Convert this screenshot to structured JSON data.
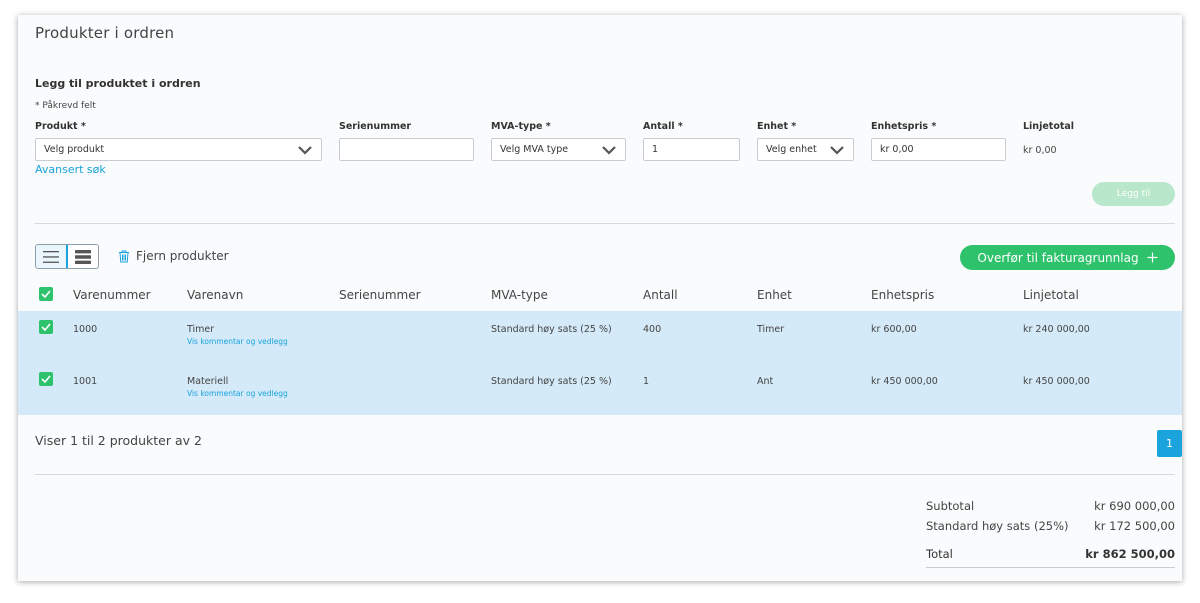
{
  "header": {
    "title": "Produkter i ordren"
  },
  "add_form": {
    "section_title": "Legg til produktet i ordren",
    "required_note": "* Påkrevd felt",
    "labels": {
      "produkt": "Produkt *",
      "serienummer": "Serienummer",
      "mva": "MVA-type *",
      "antall": "Antall *",
      "enhet": "Enhet *",
      "enhetspris": "Enhetspris *",
      "linjetotal": "Linjetotal"
    },
    "fields": {
      "produkt_placeholder": "Velg produkt",
      "serienummer_value": "",
      "mva_placeholder": "Velg MVA type",
      "antall_value": "1",
      "enhet_placeholder": "Velg enhet",
      "enhetspris_value": "kr 0,00",
      "linjetotal_value": "kr 0,00"
    },
    "advanced_search": "Avansert søk",
    "add_button": "Legg til"
  },
  "toolbar": {
    "remove_label": "Fjern produkter",
    "transfer_button": "Overfør til fakturagrunnlag",
    "transfer_icon": "plus-icon"
  },
  "table": {
    "headers": {
      "varenummer": "Varenummer",
      "varenavn": "Varenavn",
      "serienummer": "Serienummer",
      "mva": "MVA-type",
      "antall": "Antall",
      "enhet": "Enhet",
      "enhetspris": "Enhetspris",
      "linjetotal": "Linjetotal"
    },
    "rows": [
      {
        "varenummer": "1000",
        "varenavn": "Timer",
        "sublink": "Vis kommentar og vedlegg",
        "serienummer": "",
        "mva": "Standard høy sats (25 %)",
        "antall": "400",
        "enhet": "Timer",
        "enhetspris": "kr 600,00",
        "linjetotal": "kr 240 000,00"
      },
      {
        "varenummer": "1001",
        "varenavn": "Materiell",
        "sublink": "Vis kommentar og vedlegg",
        "serienummer": "",
        "mva": "Standard høy sats (25 %)",
        "antall": "1",
        "enhet": "Ant",
        "enhetspris": "kr 450 000,00",
        "linjetotal": "kr 450 000,00"
      }
    ]
  },
  "pagination": {
    "summary": "Viser 1 til 2 produkter av 2",
    "current_page": "1"
  },
  "totals": {
    "subtotal_label": "Subtotal",
    "subtotal_value": "kr 690 000,00",
    "vat_label": "Standard høy sats (25%)",
    "vat_value": "kr 172 500,00",
    "total_label": "Total",
    "total_value": "kr 862 500,00"
  },
  "colors": {
    "accent": "#1aa3dd",
    "success": "#2dc26b",
    "row_selected": "#d4eaf8"
  }
}
